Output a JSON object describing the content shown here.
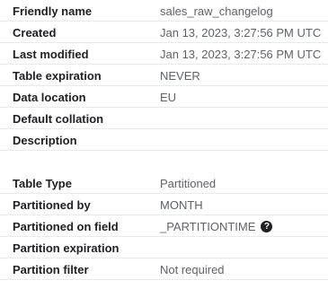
{
  "general": {
    "rows": [
      {
        "label": "Friendly name",
        "value": "sales_raw_changelog"
      },
      {
        "label": "Created",
        "value": "Jan 13, 2023, 3:27:56 PM UTC"
      },
      {
        "label": "Last modified",
        "value": "Jan 13, 2023, 3:27:56 PM UTC"
      },
      {
        "label": "Table expiration",
        "value": "NEVER"
      },
      {
        "label": "Data location",
        "value": "EU"
      },
      {
        "label": "Default collation",
        "value": ""
      },
      {
        "label": "Description",
        "value": ""
      }
    ]
  },
  "partitioning": {
    "rows": [
      {
        "label": "Table Type",
        "value": "Partitioned"
      },
      {
        "label": "Partitioned by",
        "value": "MONTH"
      },
      {
        "label": "Partitioned on field",
        "value": "_PARTITIONTIME",
        "icon": "help-icon",
        "icon_glyph": "?"
      },
      {
        "label": "Partition expiration",
        "value": ""
      },
      {
        "label": "Partition filter",
        "value": "Not required"
      }
    ]
  },
  "colors": {
    "label": "#202124",
    "value": "#5f6368",
    "divider": "#e8eaed"
  }
}
